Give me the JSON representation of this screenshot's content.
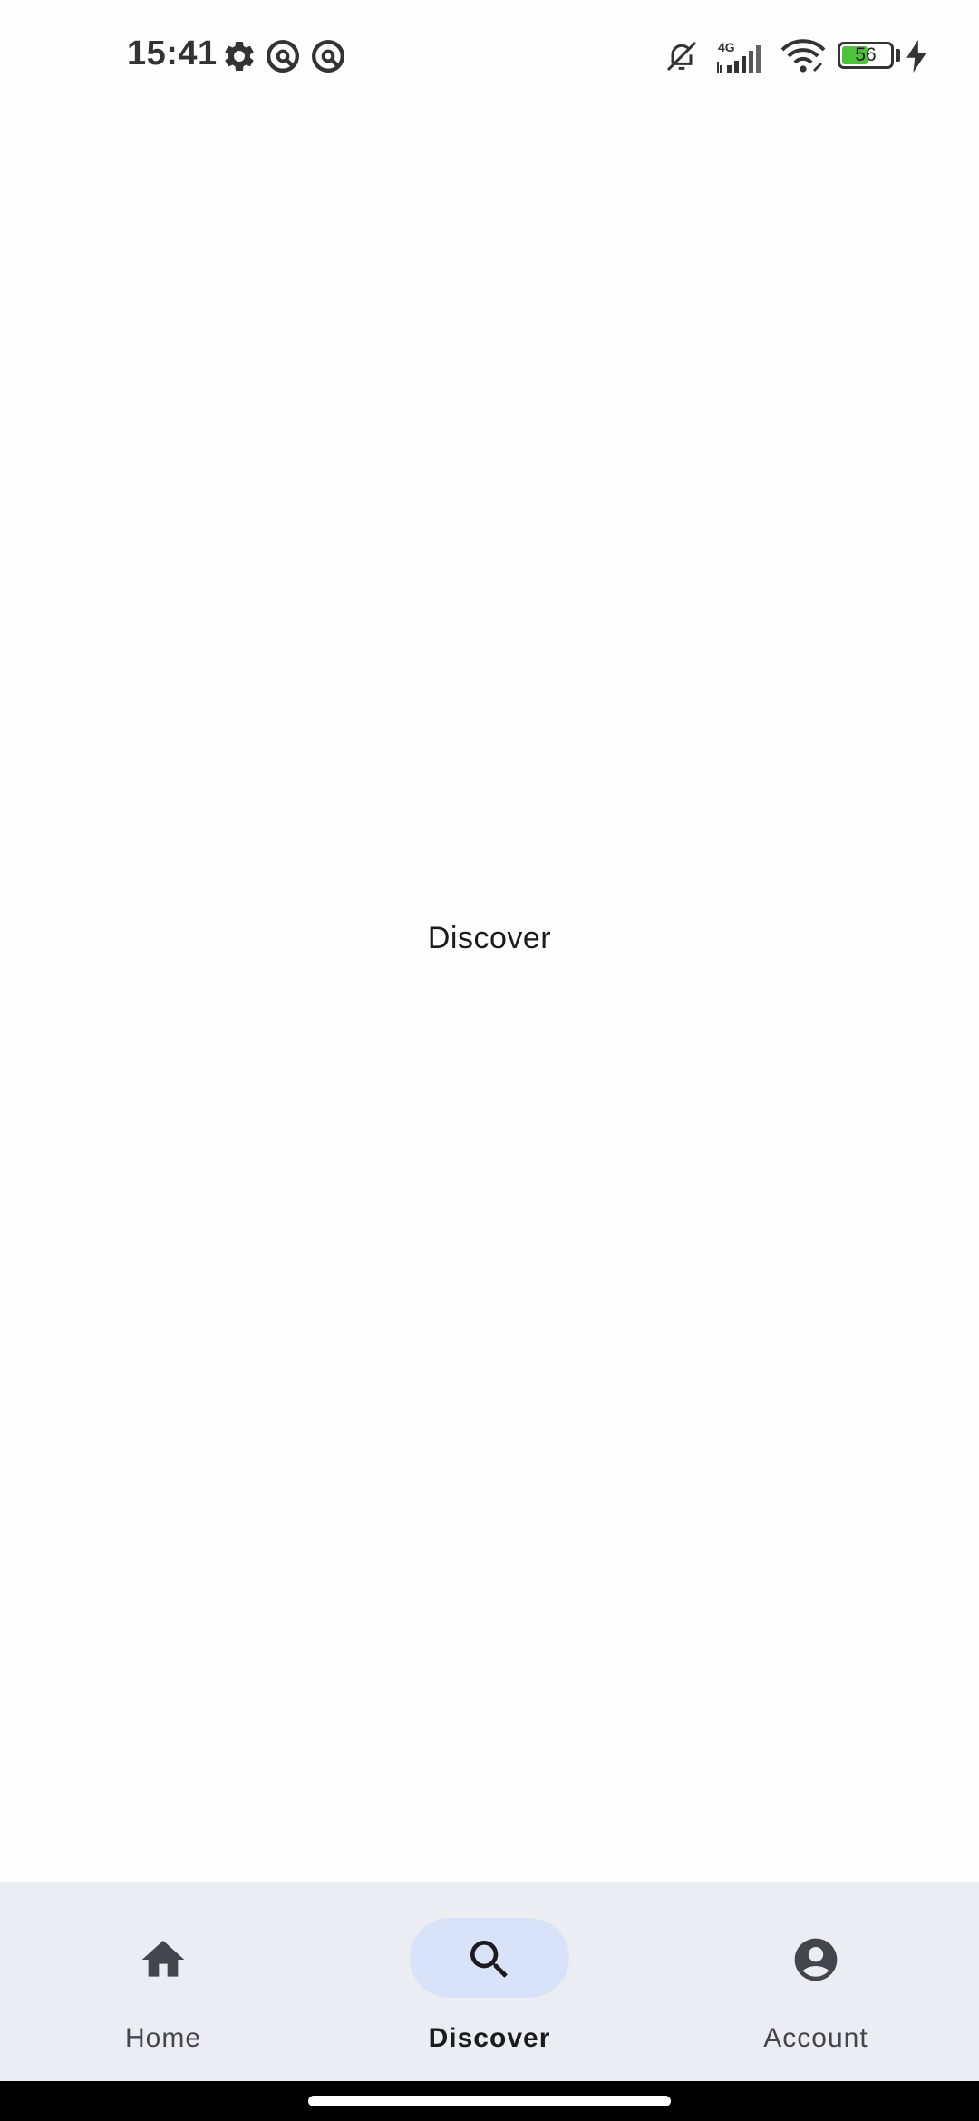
{
  "status_bar": {
    "time": "15:41",
    "network_type": "4G",
    "battery_level": "56",
    "battery_percent": 56,
    "icons": [
      "settings-icon",
      "vpn-key-icon",
      "vpn-key-icon",
      "bell-off-icon",
      "signal-icon",
      "wifi-icon",
      "battery-icon",
      "charging-icon"
    ]
  },
  "main": {
    "title": "Discover"
  },
  "bottom_nav": {
    "selected": "Discover",
    "items": [
      {
        "label": "Home",
        "icon": "home-icon"
      },
      {
        "label": "Discover",
        "icon": "search-icon"
      },
      {
        "label": "Account",
        "icon": "account-circle-icon"
      }
    ]
  },
  "colors": {
    "background": "#fefefe",
    "nav_background": "#ecedf3",
    "nav_active_pill": "#d8e2f8",
    "battery_fill": "#4cc33b"
  }
}
